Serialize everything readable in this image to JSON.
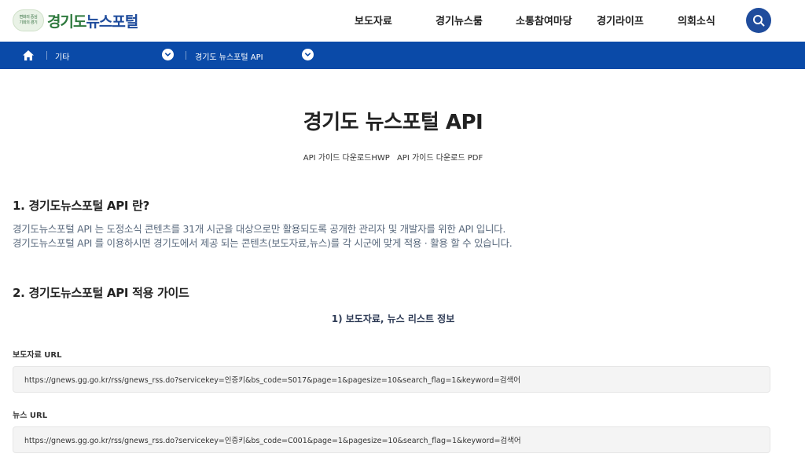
{
  "header": {
    "logo_seal": [
      "변화의 중심",
      "기회의 경기"
    ],
    "logo_text_green": "경기도",
    "logo_text_blue": "뉴스포털",
    "nav": [
      "보도자료",
      "경기뉴스룸",
      "소통참여마당",
      "경기라이프",
      "의회소식"
    ]
  },
  "breadcrumb": {
    "items": [
      "기타",
      "경기도 뉴스포털 API"
    ]
  },
  "main": {
    "title": "경기도 뉴스포털 API",
    "downloads": [
      "API 가이드 다운로드HWP",
      "API 가이드 다운로드 PDF"
    ],
    "section1_title": "1. 경기도뉴스포털 API 란?",
    "section1_lines": [
      "경기도뉴스포털 API 는 도정소식 콘텐츠를 31개 시군을 대상으로만 활용되도록 공개한 관리자 및 개발자를 위한 API 입니다.",
      "경기도뉴스포털 API 를 이용하시면 경기도에서 제공 되는 콘텐츠(보도자료,뉴스)를 각 시군에 맞게 적용 · 활용 할 수 있습니다."
    ],
    "section2_title": "2. 경기도뉴스포털 API 적용 가이드",
    "subhead": "1) 보도자료, 뉴스 리스트 정보",
    "fields": [
      {
        "label": "보도자료 URL",
        "url": "https://gnews.gg.go.kr/rss/gnews_rss.do?servicekey=인증키&bs_code=S017&page=1&pagesize=10&search_flag=1&keyword=검색어"
      },
      {
        "label": "뉴스 URL",
        "url": "https://gnews.gg.go.kr/rss/gnews_rss.do?servicekey=인증키&bs_code=C001&page=1&pagesize=10&search_flag=1&keyword=검색어"
      }
    ]
  },
  "colors": {
    "brand_blue": "#1f4c9c",
    "bar_blue": "#0a4aa8",
    "logo_green": "#2f7a3e"
  },
  "icons": [
    "home-icon",
    "chevron-down-icon",
    "search-icon"
  ]
}
